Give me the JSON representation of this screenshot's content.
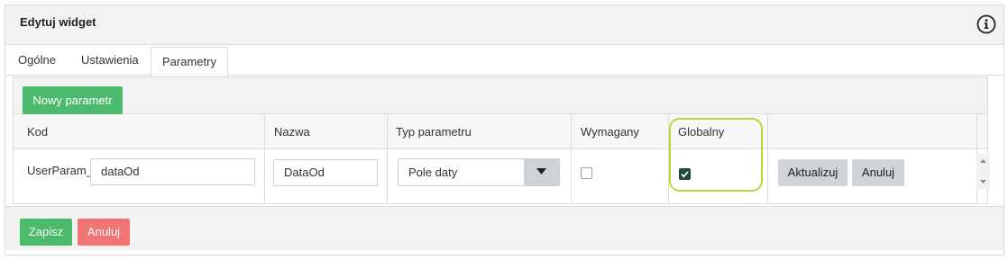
{
  "dialog": {
    "title": "Edytuj widget",
    "info_icon": "info-circle-icon"
  },
  "tabs": [
    {
      "label": "Ogólne",
      "active": false
    },
    {
      "label": "Ustawienia",
      "active": false
    },
    {
      "label": "Parametry",
      "active": true
    }
  ],
  "panel": {
    "new_param_label": "Nowy parametr",
    "columns": [
      "Kod",
      "Nazwa",
      "Typ parametru",
      "Wymagany",
      "Globalny"
    ],
    "row": {
      "code_prefix": "UserParam_",
      "code_value": "dataOd",
      "name_value": "DataOd",
      "type_value": "Pole daty",
      "required": false,
      "global": true,
      "update_label": "Aktualizuj",
      "cancel_label": "Anuluj"
    }
  },
  "footer": {
    "save_label": "Zapisz",
    "cancel_label": "Anuluj"
  },
  "colors": {
    "green": "#4cba6c",
    "red": "#f07474",
    "highlight": "#b8d73a",
    "checked": "#1f4a3e"
  }
}
